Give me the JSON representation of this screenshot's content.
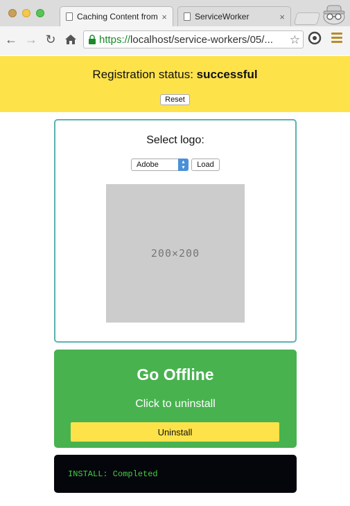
{
  "browser": {
    "tabs": [
      {
        "title": "Caching Content from",
        "active": true
      },
      {
        "title": "ServiceWorker",
        "active": false
      }
    ],
    "address_bar": {
      "scheme": "https://",
      "rest": "localhost/service-workers/05/..."
    },
    "icons": {
      "back": "back-arrow-icon",
      "forward": "forward-arrow-icon",
      "reload": "reload-icon",
      "home": "home-icon",
      "lock": "lock-icon",
      "star": "star-icon",
      "extension": "extension-icon",
      "menu": "menu-icon",
      "profile": "incognito-profile-icon"
    }
  },
  "status": {
    "label": "Registration status:",
    "value": "successful",
    "reset_label": "Reset",
    "background": "#fde24a"
  },
  "logo_selector": {
    "heading": "Select logo:",
    "selected_option": "Adobe",
    "load_label": "Load",
    "placeholder_text": "200×200",
    "border_color": "#5ab2b0"
  },
  "offline": {
    "title": "Go Offline",
    "subtitle": "Click to uninstall",
    "button_label": "Uninstall",
    "background": "#48b24f"
  },
  "console": {
    "line": "INSTALL: Completed",
    "text_color": "#3fd13f"
  }
}
